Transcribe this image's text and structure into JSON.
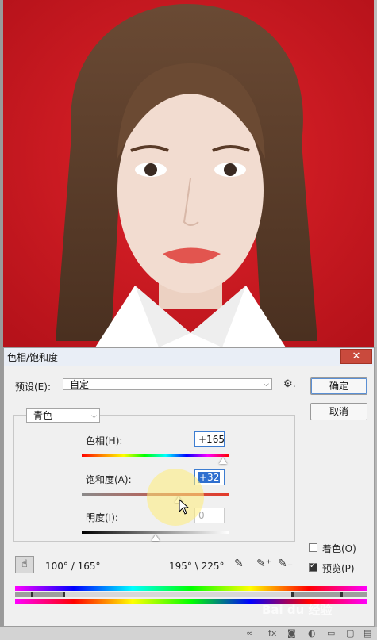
{
  "dialog": {
    "title": "色相/饱和度",
    "close_glyph": "✕",
    "preset_label": "预设(E):",
    "preset_value": "自定",
    "gear_glyph": "⚙.",
    "ok_label": "确定",
    "cancel_label": "取消",
    "channel_value": "青色",
    "hue_label": "色相(H):",
    "hue_value": "+165",
    "saturation_label": "饱和度(A):",
    "saturation_value": "+32",
    "lightness_label": "明度(I):",
    "lightness_value": "0",
    "range_left": "100° / 165°",
    "range_right": "195° \\ 225°",
    "colorize_label": "着色(O)",
    "preview_label": "预览(P)",
    "colorize_checked": false,
    "preview_checked": true,
    "hue_level": 0.96,
    "saturation_level": 0.66,
    "lightness_level": 0.5
  },
  "colors": {
    "photo_background": "#d41a1c",
    "accent": "#3d7dd1"
  },
  "icons": {
    "hand": "hand-icon",
    "gear": "gear-icon",
    "eyedropper": "eyedropper-icon",
    "eyedropper_add": "eyedropper-plus-icon",
    "eyedropper_subtract": "eyedropper-minus-icon"
  },
  "watermark": "Bai du 经验"
}
